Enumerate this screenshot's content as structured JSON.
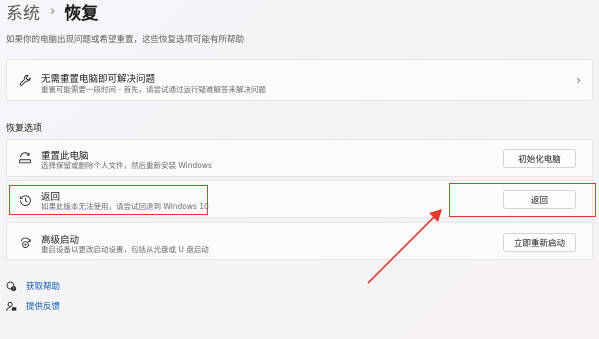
{
  "breadcrumb": {
    "parent": "系统",
    "separator": "›",
    "current": "恢复"
  },
  "page_description": "如果你的电脑出现问题或希望重置，这些恢复选项可能有所帮助",
  "troubleshoot": {
    "title": "无需重置电脑即可解决问题",
    "description": "重置可能需要一段时间 - 首先，请尝试通过运行疑难解答来解决问题",
    "icon": "wrench-icon"
  },
  "section_title": "恢复选项",
  "options": [
    {
      "title": "重置此电脑",
      "description": "选择保留或删除个人文件，然后重新安装 Windows",
      "button": "初始化电脑",
      "icon": "reset-pc-icon"
    },
    {
      "title": "返回",
      "description": "如果此版本无法使用，请尝试回退到 Windows 10",
      "button": "返回",
      "icon": "history-icon"
    },
    {
      "title": "高级启动",
      "description": "重启设备以更改启动设置，包括从光盘或 U 盘启动",
      "button": "立即重新启动",
      "icon": "advanced-startup-icon"
    }
  ],
  "links": [
    {
      "label": "获取帮助",
      "icon": "help-icon"
    },
    {
      "label": "提供反馈",
      "icon": "feedback-icon"
    }
  ],
  "colors": {
    "link": "#0b5cad",
    "annotation": "#e5382f"
  }
}
